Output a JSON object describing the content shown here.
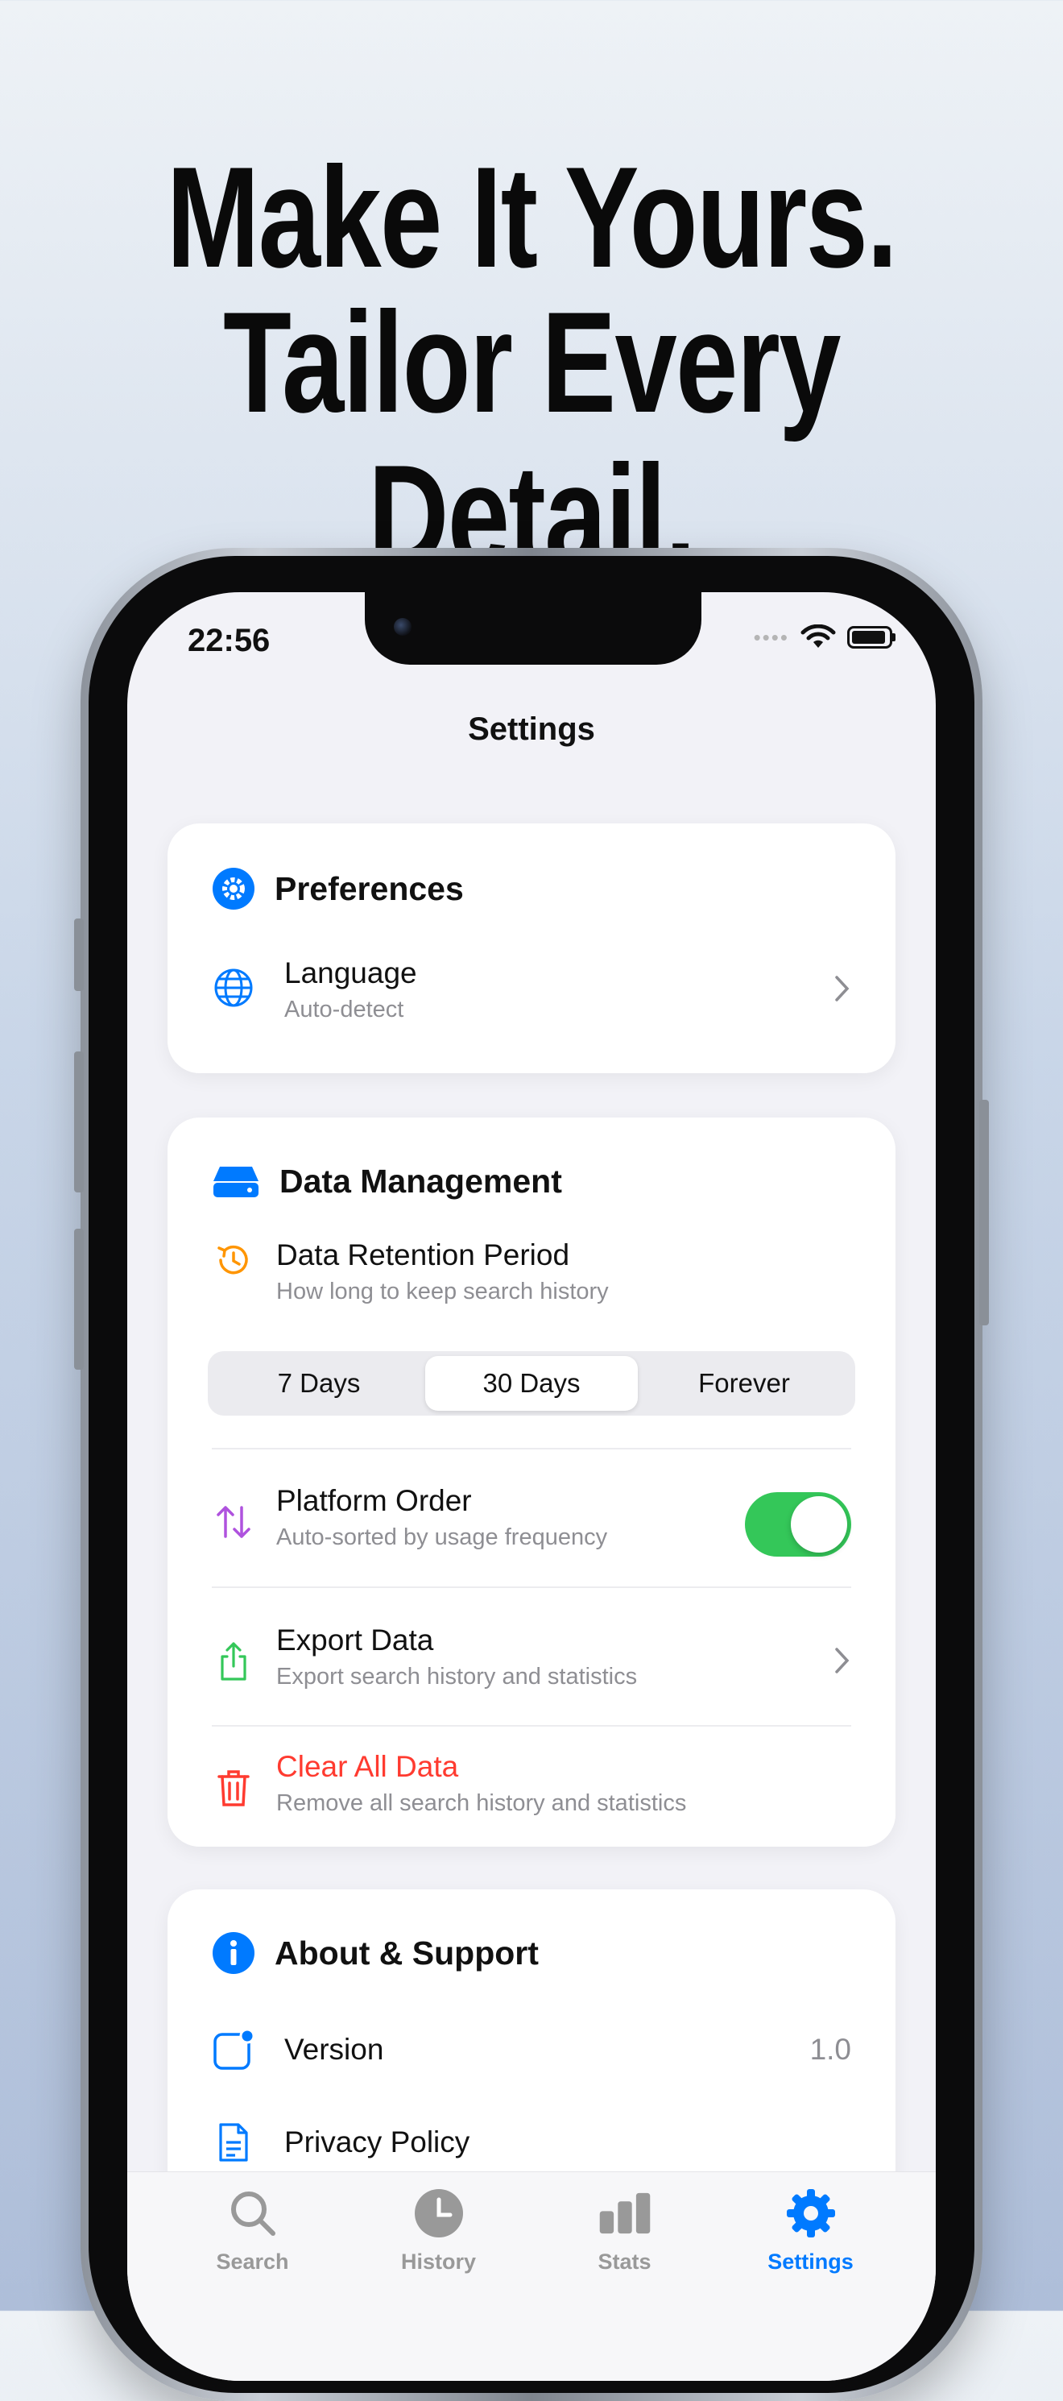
{
  "headline": {
    "line1": "Make It Yours.",
    "line2": "Tailor Every Detail."
  },
  "status_bar": {
    "time": "22:56",
    "icons": [
      "signal-dots-icon",
      "wifi-icon",
      "battery-icon"
    ]
  },
  "nav": {
    "title": "Settings"
  },
  "preferences": {
    "header": "Preferences",
    "icon": "gear-circle-icon",
    "language": {
      "label": "Language",
      "value": "Auto-detect",
      "icon": "globe-icon"
    }
  },
  "data_management": {
    "header": "Data Management",
    "icon": "drive-icon",
    "retention": {
      "label": "Data Retention Period",
      "subtitle": "How long to keep search history",
      "icon": "clock-history-icon",
      "options": [
        "7 Days",
        "30 Days",
        "Forever"
      ],
      "selected": "30 Days"
    },
    "platform_order": {
      "label": "Platform Order",
      "subtitle": "Auto-sorted by usage frequency",
      "icon": "arrows-up-down-icon",
      "enabled": true
    },
    "export": {
      "label": "Export Data",
      "subtitle": "Export search history and statistics",
      "icon": "share-icon"
    },
    "clear": {
      "label": "Clear All Data",
      "subtitle": "Remove all search history and statistics",
      "icon": "trash-icon"
    }
  },
  "about": {
    "header": "About & Support",
    "icon": "info-circle-icon",
    "version": {
      "label": "Version",
      "value": "1.0",
      "icon": "app-badge-icon"
    },
    "privacy": {
      "label": "Privacy Policy",
      "icon": "document-icon"
    }
  },
  "tabbar": {
    "tabs": [
      {
        "label": "Search",
        "icon": "magnifier-icon"
      },
      {
        "label": "History",
        "icon": "clock-icon"
      },
      {
        "label": "Stats",
        "icon": "bar-chart-icon"
      },
      {
        "label": "Settings",
        "icon": "gear-icon"
      }
    ],
    "active": "Settings"
  },
  "colors": {
    "accent": "#007aff",
    "toggle_on": "#34c759",
    "danger": "#ff3b30",
    "retention_icon": "#ff9500",
    "platform_icon": "#af52de",
    "export_icon": "#34c759"
  }
}
